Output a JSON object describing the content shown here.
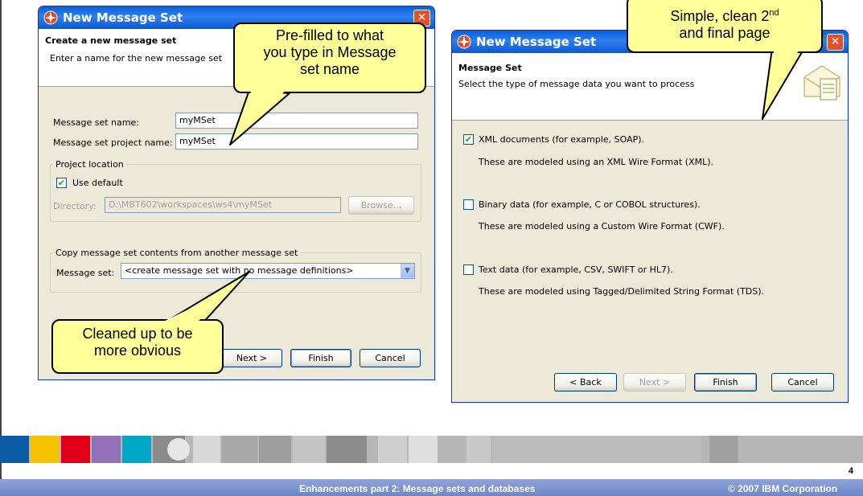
{
  "dialog1": {
    "title": "New Message Set",
    "banner_title": "Create a new message set",
    "banner_desc": "Enter a name for the new message set",
    "msgset_name_label": "Message set name:",
    "msgset_name_value": "myMSet",
    "project_name_label": "Message set project name:",
    "project_name_value": "myMSet",
    "project_location_legend": "Project location",
    "use_default_label": "Use default",
    "use_default_checked": true,
    "directory_label": "Directory:",
    "directory_value": "D:\\MBT602\\workspaces\\ws4\\myMSet",
    "browse_label": "Browse...",
    "copy_legend": "Copy message set contents from another message set",
    "message_set_label": "Message set:",
    "message_set_value": "<create message set with no message definitions>",
    "next_label": "Next >",
    "finish_label": "Finish",
    "cancel_label": "Cancel"
  },
  "dialog2": {
    "title": "New Message Set",
    "banner_title": "Message Set",
    "banner_desc": "Select the type of message data you want to process",
    "options": [
      {
        "label": "XML documents (for example, SOAP).",
        "desc": "These are modeled using an XML Wire Format (XML).",
        "checked": true
      },
      {
        "label": "Binary data (for example, C or COBOL structures).",
        "desc": "These are modeled using a Custom Wire Format (CWF).",
        "checked": false
      },
      {
        "label": "Text data (for example, CSV, SWIFT or HL7).",
        "desc": "These are modeled using Tagged/Delimited String Format (TDS).",
        "checked": false
      }
    ],
    "back_label": "< Back",
    "next_label": "Next >",
    "finish_label": "Finish",
    "cancel_label": "Cancel"
  },
  "callouts": {
    "prefilled": [
      "Pre-filled to what",
      "you type in Message",
      "set name"
    ],
    "cleaned": [
      "Cleaned up to be",
      "more obvious"
    ],
    "simple_line1": "Simple, clean 2",
    "simple_sup": "nd",
    "simple_line2": "and final page"
  },
  "footer": {
    "title": "Enhancements part 2: Message sets and databases",
    "copyright": "© 2007 IBM Corporation",
    "page": "4"
  },
  "colors": {
    "titlebar": "#0a5fd8",
    "callout_fill": "#ffff99",
    "dialog_face": "#ece9d8",
    "footer_bar": "#7f95d0"
  },
  "icons": [
    "window-app-icon",
    "close-icon",
    "envelope-icon",
    "checkbox-check-icon",
    "dropdown-arrow-icon"
  ]
}
